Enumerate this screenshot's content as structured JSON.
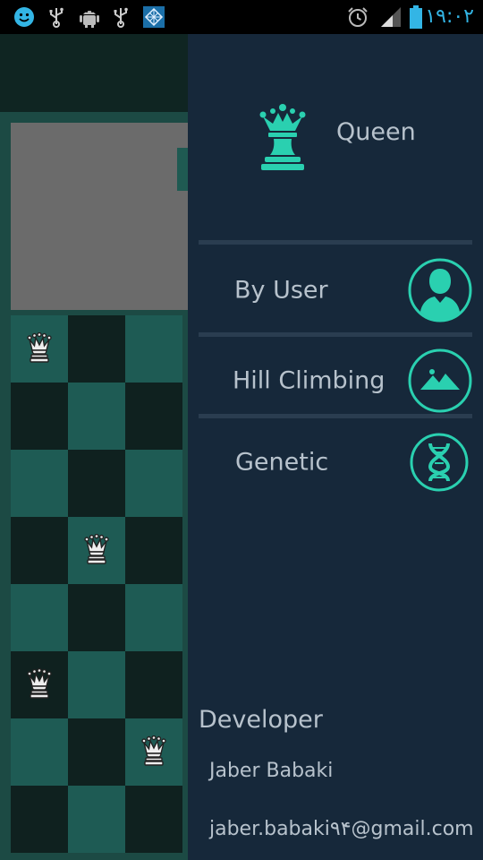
{
  "status_bar": {
    "time": "١٩:٠٢",
    "icons": [
      "smiley-icon",
      "usb-icon",
      "android-debug-icon",
      "usb-icon",
      "app-grid-icon",
      "alarm-icon",
      "signal-icon",
      "battery-icon"
    ]
  },
  "background_app": {
    "board": {
      "columns_visible": 3,
      "rows": 8,
      "queens": [
        [
          0,
          0
        ],
        [
          3,
          1
        ],
        [
          5,
          0
        ],
        [
          6,
          2
        ]
      ]
    }
  },
  "drawer": {
    "app_title": "Queen",
    "logo_icon": "queen-chess-icon",
    "menu": [
      {
        "label": "By User",
        "icon": "user-icon"
      },
      {
        "label": "Hill Climbing",
        "icon": "mountain-icon"
      },
      {
        "label": "Genetic",
        "icon": "dna-icon"
      }
    ],
    "developer": {
      "title": "Developer",
      "name": "Jaber Babaki",
      "email": "jaber.babaki٩۴@gmail.com"
    }
  },
  "colors": {
    "accent": "#2ad0b0",
    "drawer_bg": "#16283a",
    "text": "#b7c2cc",
    "status_time": "#33b5e5"
  }
}
